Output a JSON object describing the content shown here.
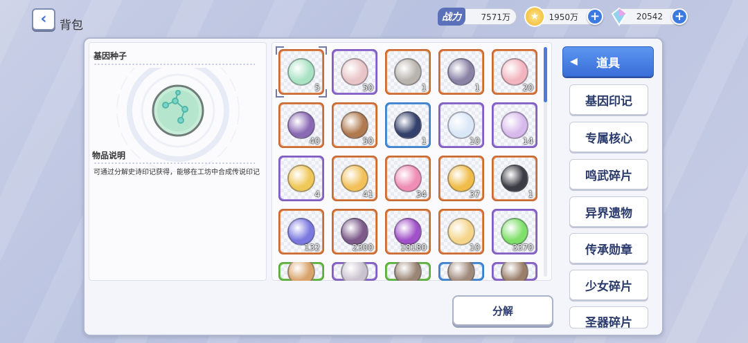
{
  "header": {
    "title": "背包",
    "back_icon": "chevron-left-icon",
    "power_label": "战力",
    "power_value": "7571万",
    "coin_value": "1950万",
    "gem_value": "20542"
  },
  "detail": {
    "item_name": "基因种子",
    "desc_title": "物品说明",
    "description": "可通过分解史诗印记获得，能够在工坊中合成传说印记"
  },
  "items": [
    {
      "qty": "5",
      "rarity": "orange",
      "icon": "gene-seed-icon",
      "color": "#a9e3c4"
    },
    {
      "qty": "50",
      "rarity": "purple",
      "icon": "dna-badge-icon",
      "color": "#e8c4c7"
    },
    {
      "qty": "1",
      "rarity": "orange",
      "icon": "cube-box-icon",
      "color": "#b8b3ad"
    },
    {
      "qty": "1",
      "rarity": "orange",
      "icon": "purple-cube-icon",
      "color": "#8a83a6"
    },
    {
      "qty": "20",
      "rarity": "orange",
      "icon": "gift-bag-icon",
      "color": "#f2b5bf"
    },
    {
      "qty": "40",
      "rarity": "orange",
      "icon": "core-chip-icon",
      "color": "#8b6ab5"
    },
    {
      "qty": "50",
      "rarity": "orange",
      "icon": "wood-box-icon",
      "color": "#b07a4e"
    },
    {
      "qty": "1",
      "rarity": "blue",
      "icon": "star-chest-icon",
      "color": "#33406b"
    },
    {
      "qty": "10",
      "rarity": "purple",
      "icon": "ticket-blue-icon",
      "color": "#d9e7f7"
    },
    {
      "qty": "14",
      "rarity": "purple",
      "icon": "ticket-pink-icon",
      "color": "#d8b9ec"
    },
    {
      "qty": "4",
      "rarity": "purple",
      "icon": "gold-card-icon",
      "color": "#f0c858"
    },
    {
      "qty": "41",
      "rarity": "orange",
      "icon": "gold-fragment-icon",
      "color": "#f2c15a"
    },
    {
      "qty": "34",
      "rarity": "orange",
      "icon": "pink-card-icon",
      "color": "#ef8db5"
    },
    {
      "qty": "37",
      "rarity": "orange",
      "icon": "sword-card-icon",
      "color": "#f0bd4a"
    },
    {
      "qty": "1",
      "rarity": "orange",
      "icon": "id-card-icon",
      "color": "#3c3c44"
    },
    {
      "qty": "132",
      "rarity": "orange",
      "icon": "blue-sword-card-icon",
      "color": "#7b78e0"
    },
    {
      "qty": "2300",
      "rarity": "orange",
      "icon": "dust-icon",
      "color": "#7d5a8a"
    },
    {
      "qty": "18180",
      "rarity": "orange",
      "icon": "crystal-icon",
      "color": "#a050c8"
    },
    {
      "qty": "10",
      "rarity": "orange",
      "icon": "star-card-icon",
      "color": "#f5d58a"
    },
    {
      "qty": "3370",
      "rarity": "purple",
      "icon": "green-potion-icon",
      "color": "#7fe06a"
    },
    {
      "qty": "",
      "rarity": "green",
      "icon": "item-icon",
      "color": "#d9a36a"
    },
    {
      "qty": "",
      "rarity": "purple",
      "icon": "item-icon",
      "color": "#c9c3cf"
    },
    {
      "qty": "",
      "rarity": "green",
      "icon": "item-icon",
      "color": "#9a8575"
    },
    {
      "qty": "",
      "rarity": "blue",
      "icon": "item-icon",
      "color": "#a08a7c"
    },
    {
      "qty": "",
      "rarity": "purple",
      "icon": "item-icon",
      "color": "#9a7e6a"
    }
  ],
  "tabs": [
    {
      "label": "道具",
      "active": true
    },
    {
      "label": "基因印记",
      "active": false
    },
    {
      "label": "专属核心",
      "active": false
    },
    {
      "label": "鸣武碎片",
      "active": false
    },
    {
      "label": "异界遗物",
      "active": false
    },
    {
      "label": "传承勋章",
      "active": false
    },
    {
      "label": "少女碎片",
      "active": false
    },
    {
      "label": "圣器碎片",
      "active": false
    }
  ],
  "decompose_label": "分解"
}
